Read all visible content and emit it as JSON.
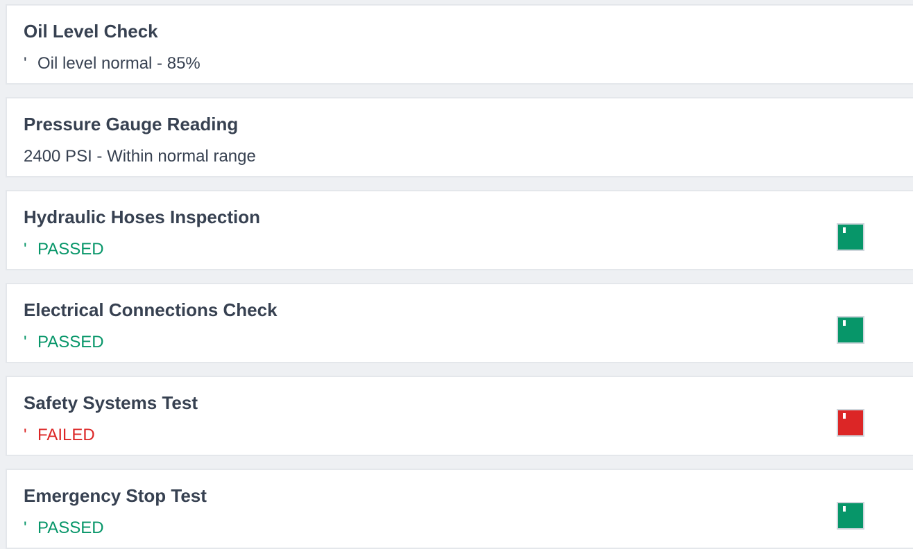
{
  "colors": {
    "passed": "#079669",
    "failed": "#dc2626",
    "text": "#374151",
    "card_border": "#e4e7eb"
  },
  "checklist": [
    {
      "title": "Oil Level Check",
      "tick": "'",
      "status": "Oil level normal - 85%",
      "state": "note"
    },
    {
      "title": "Pressure Gauge Reading",
      "tick": "",
      "status": "2400 PSI - Within normal range",
      "state": "note"
    },
    {
      "title": "Hydraulic Hoses Inspection",
      "tick": "'",
      "status": "PASSED",
      "state": "passed",
      "icon": "checkbox-passed-icon"
    },
    {
      "title": "Electrical Connections Check",
      "tick": "'",
      "status": "PASSED",
      "state": "passed",
      "icon": "checkbox-passed-icon"
    },
    {
      "title": "Safety Systems Test",
      "tick": "'",
      "status": "FAILED",
      "state": "failed",
      "icon": "checkbox-failed-icon"
    },
    {
      "title": "Emergency Stop Test",
      "tick": "'",
      "status": "PASSED",
      "state": "passed",
      "icon": "checkbox-passed-icon"
    }
  ]
}
